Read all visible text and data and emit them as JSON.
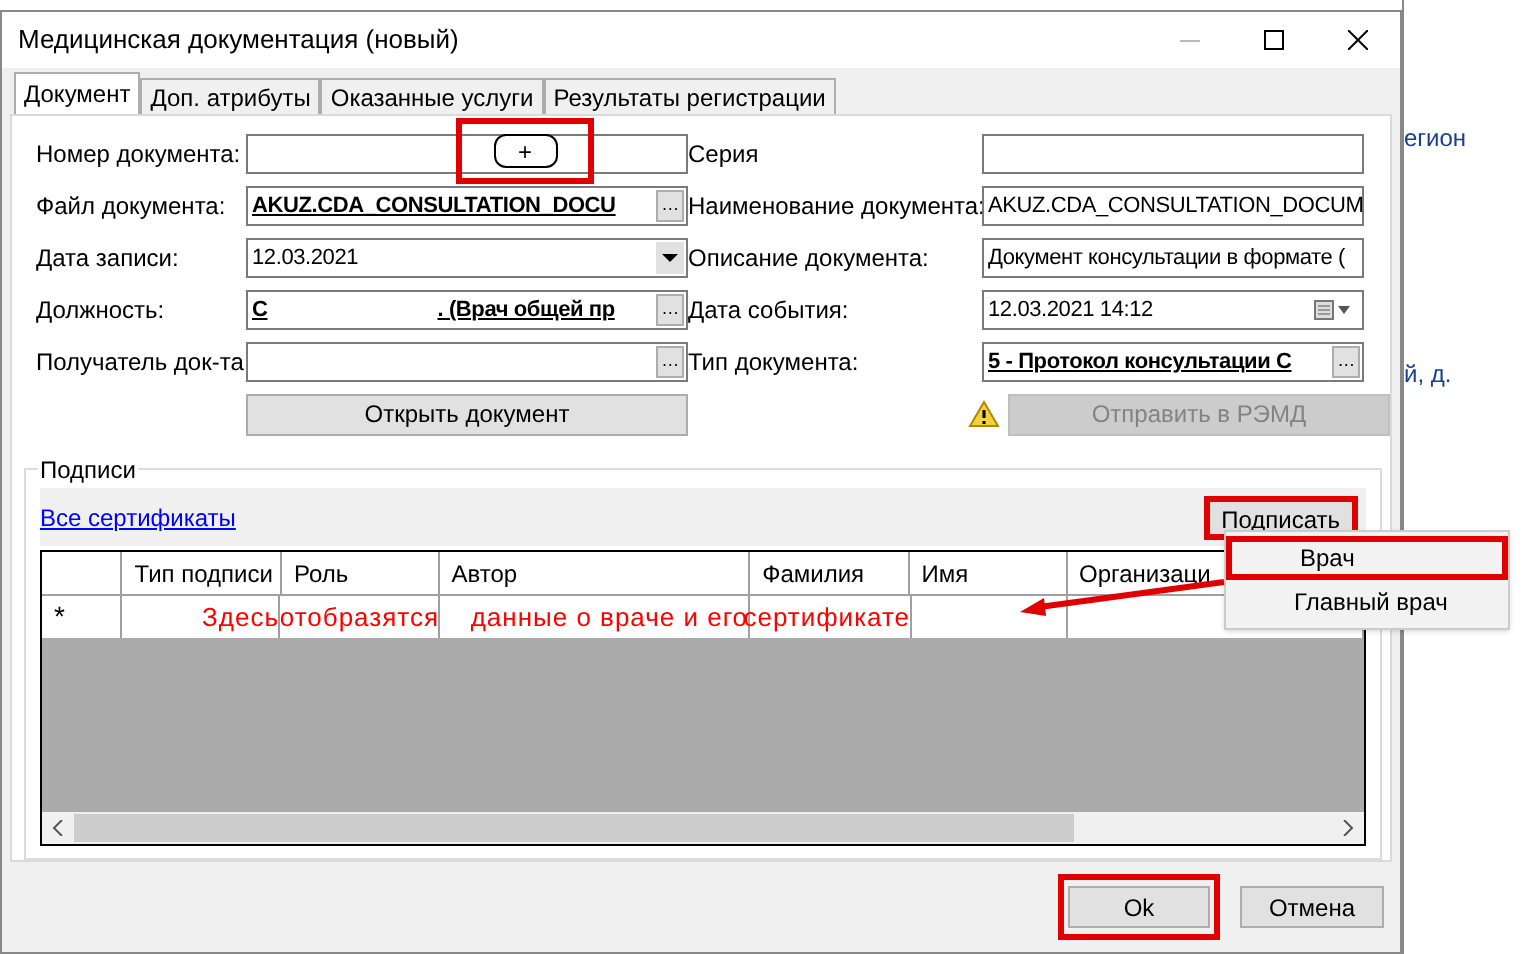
{
  "window": {
    "title": "Медицинская документация (новый)"
  },
  "tabs": [
    {
      "label": "Документ",
      "selected": true
    },
    {
      "label": "Доп. атрибуты",
      "selected": false
    },
    {
      "label": "Оказанные услуги",
      "selected": false
    },
    {
      "label": "Результаты регистрации",
      "selected": false
    }
  ],
  "add_button": {
    "label": "+",
    "highlighted": true
  },
  "left_fields": [
    {
      "label": "Номер документа:",
      "kind": "text"
    },
    {
      "label": "Файл документа:",
      "kind": "lookup",
      "value": "AKUZ.CDA_CONSULTATION_DOCU",
      "bold": true,
      "button": "…"
    },
    {
      "label": "Дата записи:",
      "kind": "dropdown",
      "value": "12.03.2021",
      "bold": false
    },
    {
      "label": "Должность:",
      "kind": "lookup",
      "value": "С",
      "value_end": ". (Врач общей пр",
      "bold": true,
      "button": "…"
    },
    {
      "label": "Получатель док-та",
      "kind": "lookup",
      "button": "…"
    }
  ],
  "open_button": {
    "label": "Открыть документ"
  },
  "right_fields": [
    {
      "label": "Серия",
      "kind": "text"
    },
    {
      "label": "Наименование документа:",
      "kind": "text",
      "value": "AKUZ.CDA_CONSULTATION_DOCUM",
      "bold": false
    },
    {
      "label": "Описание документа:",
      "kind": "text",
      "value": "Документ консультации в формате (",
      "bold": false
    },
    {
      "label": "Дата события:",
      "kind": "datetime",
      "value": "12.03.2021 14:12",
      "bold": false
    },
    {
      "label": "Тип документа:",
      "kind": "lookup",
      "value": "5 - Протокол консультации С",
      "bold": true,
      "button": "…"
    }
  ],
  "send_button": {
    "label": "Отправить в РЭМД",
    "disabled": true
  },
  "signatures": {
    "title": "Подписи",
    "link": "Все сертификаты",
    "sign_button": {
      "label": "Подписать",
      "highlighted": true
    },
    "columns": [
      "Тип подписи",
      "Роль",
      "Автор",
      "Фамилия",
      "Имя",
      "Организаци"
    ],
    "new_row": {
      "marker": "*",
      "cells": [
        "Здесь",
        "отобразятся",
        "данные о враче и его",
        "сертификате"
      ]
    }
  },
  "sign_menu": [
    {
      "label": "Врач",
      "highlighted": true
    },
    {
      "label": "Главный врач",
      "highlighted": false
    }
  ],
  "footer": {
    "ok": {
      "label": "Ok",
      "highlighted": true
    },
    "cancel": {
      "label": "Отмена"
    }
  },
  "background": {
    "texts": [
      "егион",
      "й, д."
    ]
  }
}
